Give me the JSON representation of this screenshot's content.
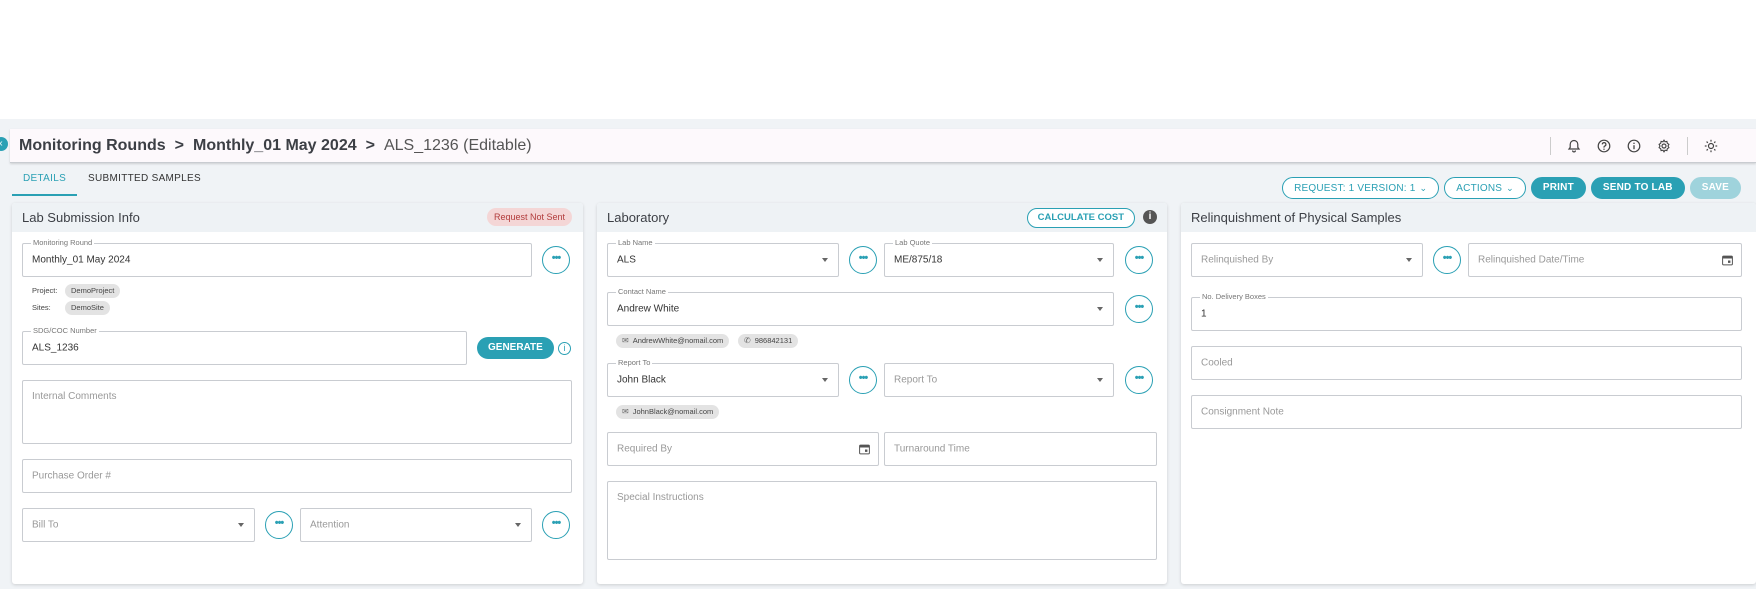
{
  "breadcrumb": {
    "items": [
      "Monitoring Rounds",
      "Monthly_01 May 2024"
    ],
    "separator": ">",
    "current": "ALS_1236 (Editable)"
  },
  "header_icons": [
    "bell-icon",
    "help-icon",
    "info-icon",
    "gear-icon",
    "sun-icon"
  ],
  "tabs": [
    {
      "label": "DETAILS",
      "active": true
    },
    {
      "label": "SUBMITTED SAMPLES",
      "active": false
    }
  ],
  "toolbar": {
    "request_version_label": "REQUEST: 1 VERSION: 1",
    "actions_label": "ACTIONS",
    "print_label": "PRINT",
    "send_label": "SEND TO LAB",
    "save_label": "SAVE"
  },
  "lab_submission": {
    "title": "Lab Submission Info",
    "status": "Request Not Sent",
    "monitoring_round_label": "Monitoring Round",
    "monitoring_round_value": "Monthly_01 May 2024",
    "project_label": "Project:",
    "project_value": "DemoProject",
    "sites_label": "Sites:",
    "sites_value": "DemoSite",
    "sdg_label": "SDG/COC Number",
    "sdg_value": "ALS_1236",
    "generate_label": "GENERATE",
    "internal_comments_placeholder": "Internal Comments",
    "purchase_order_placeholder": "Purchase Order #",
    "bill_to_placeholder": "Bill To",
    "attention_placeholder": "Attention"
  },
  "laboratory": {
    "title": "Laboratory",
    "calculate_cost_label": "CALCULATE COST",
    "lab_name_label": "Lab Name",
    "lab_name_value": "ALS",
    "lab_quote_label": "Lab Quote",
    "lab_quote_value": "ME/875/18",
    "contact_name_label": "Contact Name",
    "contact_name_value": "Andrew White",
    "contact_email": "AndrewWhite@nomail.com",
    "contact_phone": "986842131",
    "report_to_label": "Report To",
    "report_to_value": "John Black",
    "report_to_email": "JohnBlack@nomail.com",
    "report_to_2_placeholder": "Report To",
    "required_by_placeholder": "Required By",
    "turnaround_placeholder": "Turnaround Time",
    "special_instructions_placeholder": "Special Instructions"
  },
  "relinquishment": {
    "title": "Relinquishment of Physical Samples",
    "relinquished_by_placeholder": "Relinquished By",
    "relinquished_date_placeholder": "Relinquished Date/Time",
    "delivery_boxes_label": "No. Delivery Boxes",
    "delivery_boxes_value": "1",
    "cooled_placeholder": "Cooled",
    "consignment_note_placeholder": "Consignment Note"
  },
  "colors": {
    "accent": "#2aa0b4",
    "status_bg": "#f4d6d6",
    "status_text": "#b23c3c"
  }
}
